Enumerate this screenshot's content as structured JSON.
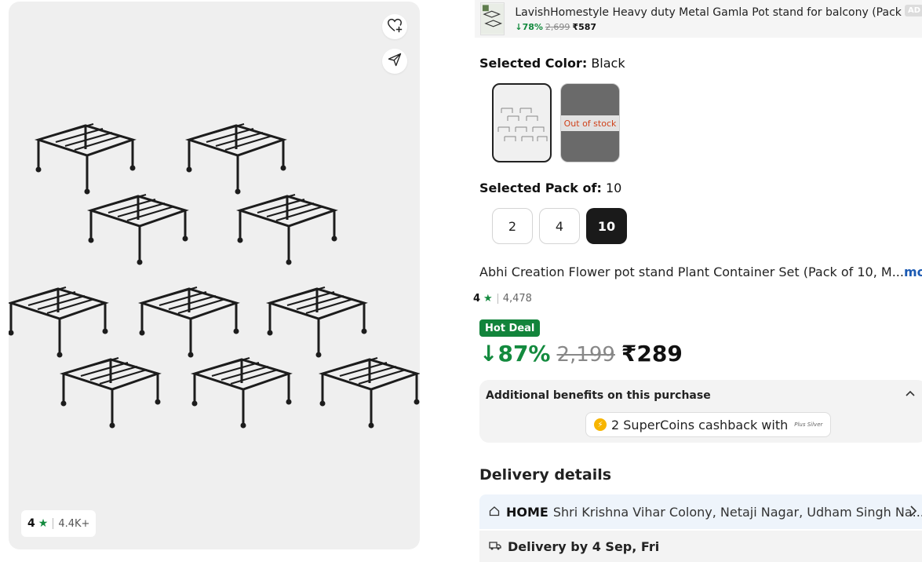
{
  "gallery": {
    "rating": "4",
    "star": "★",
    "review_count": "4.4K+",
    "icons": [
      "wishlist-add-icon",
      "share-icon"
    ]
  },
  "ad": {
    "title": "LavishHomestyle Heavy duty Metal Gamla Pot stand for balcony (Pack o...",
    "discount": "↓78%",
    "mrp": "2,699",
    "price": "₹587",
    "tag": "AD"
  },
  "color": {
    "label": "Selected Color:",
    "value": "Black",
    "out_of_stock": "Out of stock"
  },
  "pack": {
    "label": "Selected Pack of:",
    "value": "10",
    "options": [
      "2",
      "4",
      "10"
    ]
  },
  "product": {
    "name": "Abhi Creation Flower pot stand Plant Container Set (Pack of 10, M...",
    "more": "more",
    "rating": "4",
    "star": "★",
    "rating_count": "4,478"
  },
  "deal": {
    "badge": "Hot Deal",
    "discount": "↓87%",
    "mrp": "2,199",
    "price": "₹289"
  },
  "benefits": {
    "title": "Additional benefits on this purchase",
    "supercoins": "2 SuperCoins cashback with",
    "plus_tag": "Plus Silver"
  },
  "delivery": {
    "title": "Delivery details",
    "address_label": "HOME",
    "address": "Shri Krishna Vihar Colony, Netaji Nagar, Udham Singh Na...",
    "eta": "Delivery by 4 Sep, Fri"
  },
  "colors": {
    "green": "#138a3e",
    "link": "#1d5bb3",
    "active": "#1a1a1a"
  }
}
